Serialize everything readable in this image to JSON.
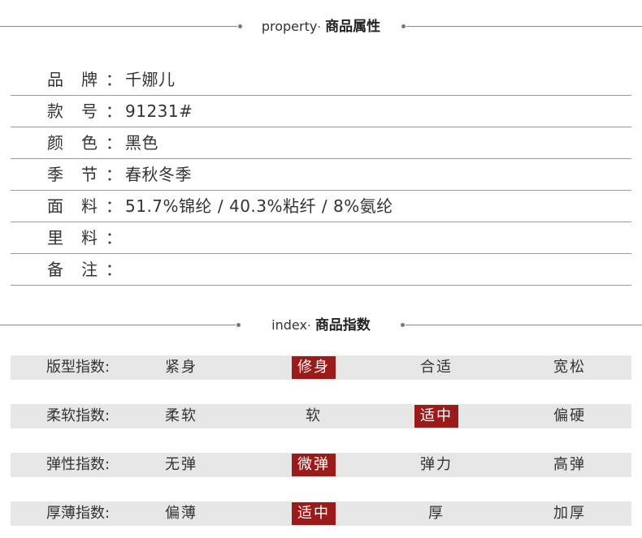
{
  "property_section": {
    "en": "property",
    "sep": "·",
    "cn": "商品属性"
  },
  "properties": [
    {
      "l1": "品",
      "l2": "牌",
      "colon": "：",
      "value": "千娜儿"
    },
    {
      "l1": "款",
      "l2": "号",
      "colon": "：",
      "value": "91231#"
    },
    {
      "l1": "颜",
      "l2": "色",
      "colon": "：",
      "value": "黑色"
    },
    {
      "l1": "季",
      "l2": "节",
      "colon": "：",
      "value": "春秋冬季"
    },
    {
      "l1": "面",
      "l2": "料",
      "colon": "：",
      "value": "51.7%锦纶 / 40.3%粘纤 / 8%氨纶"
    },
    {
      "l1": "里",
      "l2": "料",
      "colon": "：",
      "value": ""
    },
    {
      "l1": "备",
      "l2": "注",
      "colon": "：",
      "value": ""
    }
  ],
  "index_section": {
    "en": "index",
    "sep": "·",
    "cn": "商品指数"
  },
  "indexes": [
    {
      "name": "版型指数:",
      "options": [
        "紧身",
        "修身",
        "合适",
        "宽松"
      ],
      "selected": 1
    },
    {
      "name": "柔软指数:",
      "options": [
        "柔软",
        "软",
        "适中",
        "偏硬"
      ],
      "selected": 2
    },
    {
      "name": "弹性指数:",
      "options": [
        "无弹",
        "微弹",
        "弹力",
        "高弹"
      ],
      "selected": 1
    },
    {
      "name": "厚薄指数:",
      "options": [
        "偏薄",
        "适中",
        "厚",
        "加厚"
      ],
      "selected": 1
    }
  ],
  "colors": {
    "highlight": "#9b1b1b",
    "row_bg": "#e6e6e6",
    "rule": "#999999"
  }
}
